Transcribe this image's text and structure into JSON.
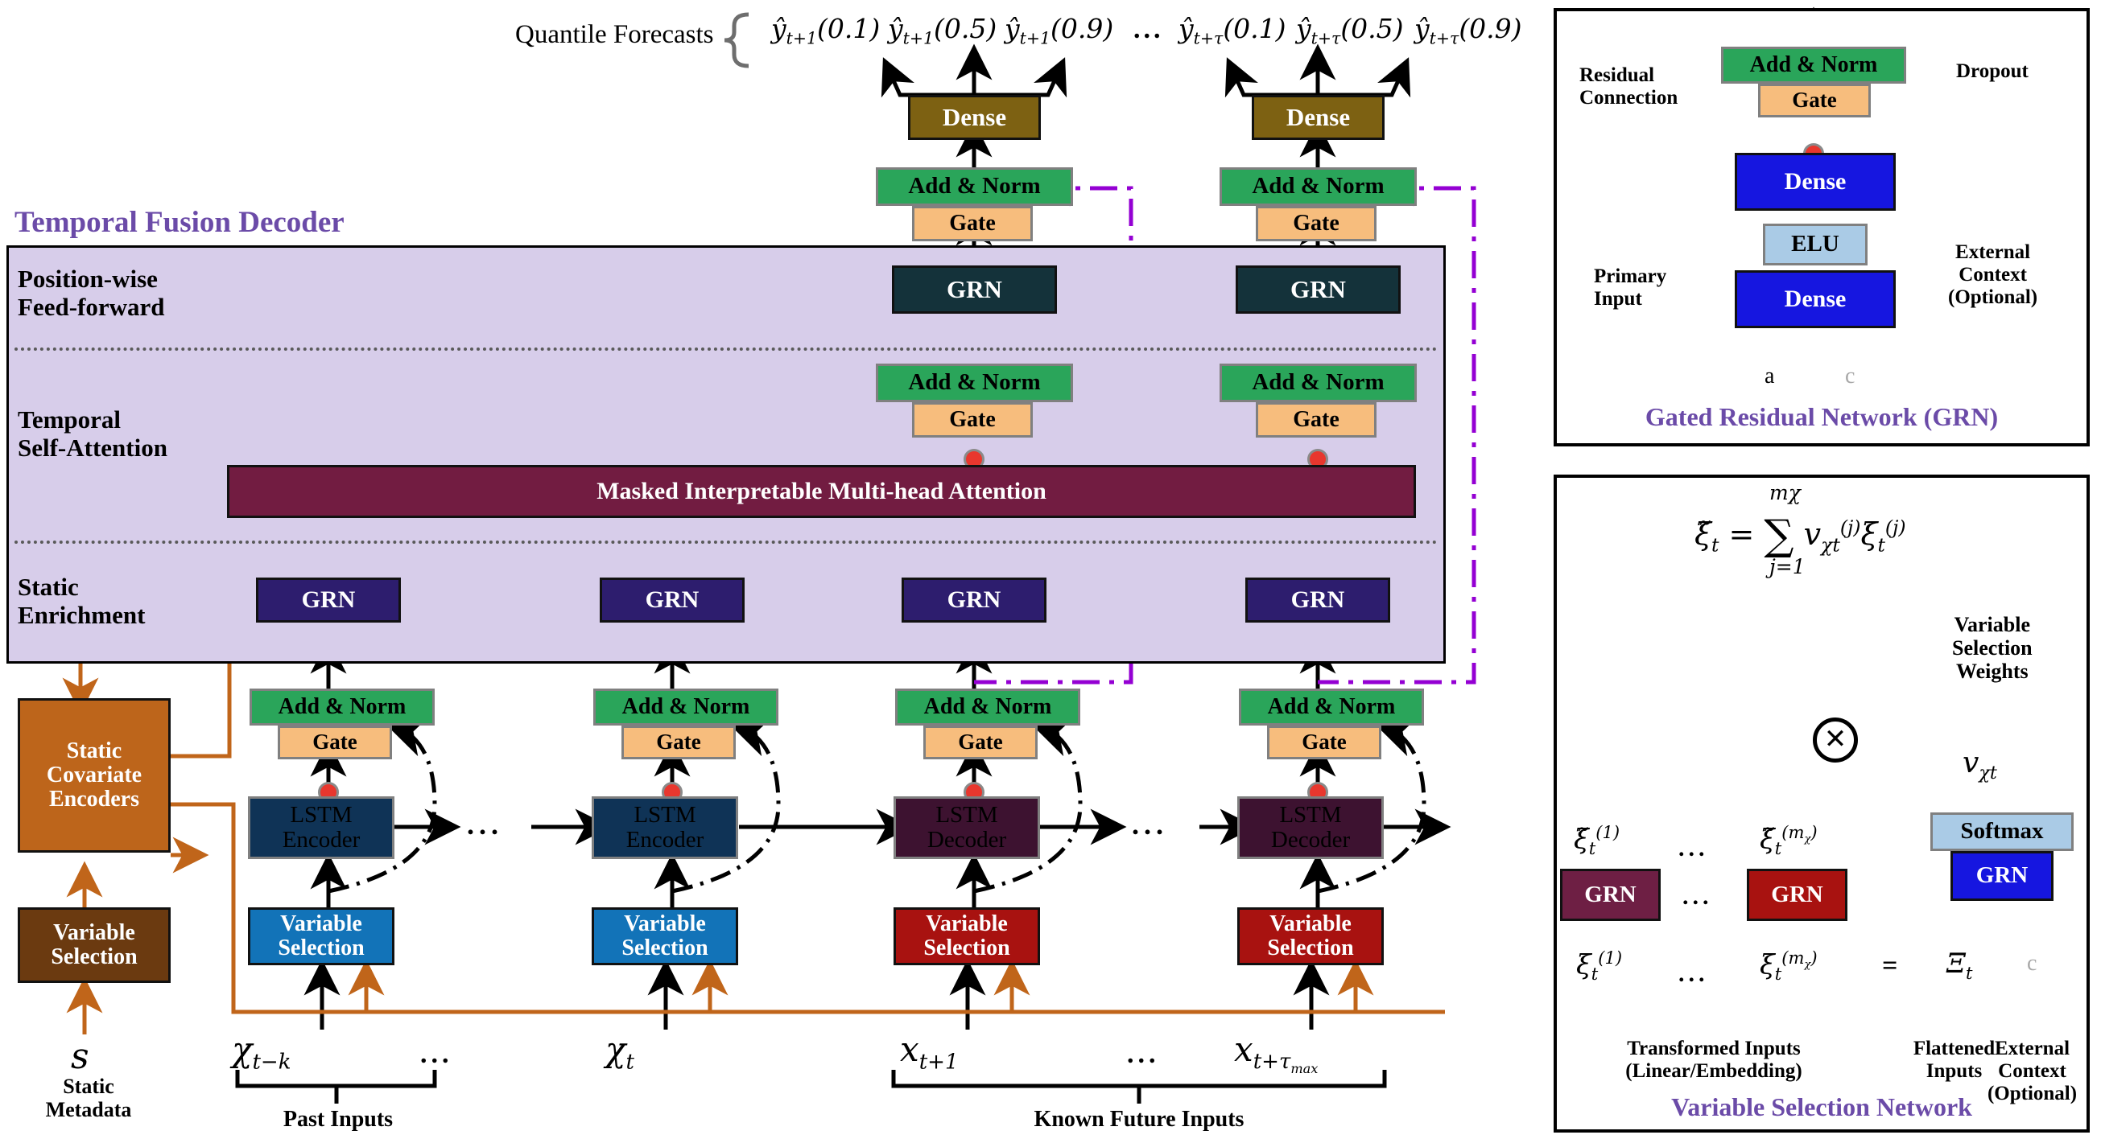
{
  "titles": {
    "temporal_fusion_decoder": "Temporal Fusion Decoder",
    "grn_panel": "Gated Residual Network (GRN)",
    "vsn_panel": "Variable Selection Network"
  },
  "sections": {
    "position_wise": "Position-wise\nFeed-forward",
    "position_wise_l1": "Position-wise",
    "position_wise_l2": "Feed-forward",
    "temporal_attn_l1": "Temporal",
    "temporal_attn_l2": "Self-Attention",
    "static_enrich_l1": "Static",
    "static_enrich_l2": "Enrichment"
  },
  "outputs": {
    "bracket_label": "Quantile Forecasts",
    "ellipsis": "...",
    "quantiles_near": [
      "ŷ",
      "ŷ",
      "ŷ"
    ],
    "q_near": [
      {
        "sub": "t+1",
        "q": "(0.1)"
      },
      {
        "sub": "t+1",
        "q": "(0.5)"
      },
      {
        "sub": "t+1",
        "q": "(0.9)"
      }
    ],
    "q_far": [
      {
        "sub": "t+τ",
        "q": "(0.1)"
      },
      {
        "sub": "t+τ",
        "q": "(0.5)"
      },
      {
        "sub": "t+τ",
        "q": "(0.9)"
      }
    ]
  },
  "blocks": {
    "dense": "Dense",
    "add_norm": "Add & Norm",
    "gate": "Gate",
    "grn": "GRN",
    "elu": "ELU",
    "softmax": "Softmax",
    "attention": "Masked Interpretable Multi-head Attention",
    "lstm_encoder_l1": "LSTM",
    "lstm_encoder_l2": "Encoder",
    "lstm_decoder_l1": "LSTM",
    "lstm_decoder_l2": "Decoder",
    "variable_selection_l1": "Variable",
    "variable_selection_l2": "Selection",
    "static_covariate_l1": "Static",
    "static_covariate_l2": "Covariate",
    "static_covariate_l3": "Encoders"
  },
  "inputs": {
    "static_symbol": "s",
    "static_metadata_l1": "Static",
    "static_metadata_l2": "Metadata",
    "past_inputs_label": "Past Inputs",
    "known_future_label": "Known Future Inputs",
    "ellipsis": "...",
    "x_past_first_base": "χ",
    "x_past_first_sub": "t−k",
    "x_past_last_base": "χ",
    "x_past_last_sub": "t",
    "x_fut_first_base": "x",
    "x_fut_first_sub": "t+1",
    "x_fut_last_base": "x",
    "x_fut_last_sub": "t+τmax"
  },
  "grn_panel": {
    "residual_l1": "Residual",
    "residual_l2": "Connection",
    "dropout": "Dropout",
    "primary_l1": "Primary",
    "primary_l2": "Input",
    "external_l1": "External",
    "external_l2": "Context",
    "external_l3": "(Optional)",
    "input_a": "a",
    "input_c": "c"
  },
  "vsn_panel": {
    "equation": "ξ̃ₜ = ∑ vᵩₜ⁽ʲ⁾ ξₜ⁽ʲ⁾",
    "sum_upper": "mχ",
    "sum_lower": "j=1",
    "weights_l1": "Variable",
    "weights_l2": "Selection",
    "weights_l3": "Weights",
    "v_symbol": "v",
    "v_sub": "χt",
    "xi_tilde_1": "ξ̃",
    "xi_tilde_1_sup": "(1)",
    "xi_tilde_m_sup": "(mχ)",
    "xi_1_sup": "(1)",
    "xi_m_sup": "(mχ)",
    "xi_sub": "t",
    "equals": "=",
    "xi_capital": "Ξ",
    "xi_capital_sub": "t",
    "ctx_c": "c",
    "ellipsis": "...",
    "transformed_l1": "Transformed Inputs",
    "transformed_l2": "(Linear/Embedding)",
    "flattened_l1": "Flattened",
    "flattened_l2": "Inputs",
    "external_l1": "External",
    "external_l2": "Context",
    "external_l3": "(Optional)"
  },
  "colors": {
    "decoder_region": "#d7cdea",
    "title_purple": "#6b4ba8",
    "add_norm_green": "#2aa55a",
    "gate_orange": "#f7bd7d",
    "dense_gold": "#7d6112",
    "dense_blue": "#1616e0",
    "elu_lightblue": "#aacbe6",
    "softmax_lightblue": "#aacbe6",
    "grn_darkteal": "#14323a",
    "grn_indigo": "#2d1d6e",
    "grn_maroon": "#6e1f44",
    "grn_red": "#a81210",
    "attention_maroon": "#721c41",
    "lstm_encoder_navy": "#0f3356",
    "lstm_decoder_plum": "#3d1230",
    "varsel_blue": "#1273b8",
    "varsel_red": "#a81210",
    "static_encoder_orange": "#bd651b",
    "static_varsel_brown": "#6b3a10",
    "dropout_red": "#e8372e",
    "orange_wire": "#c0651a",
    "purple_wire": "#9400d3"
  }
}
